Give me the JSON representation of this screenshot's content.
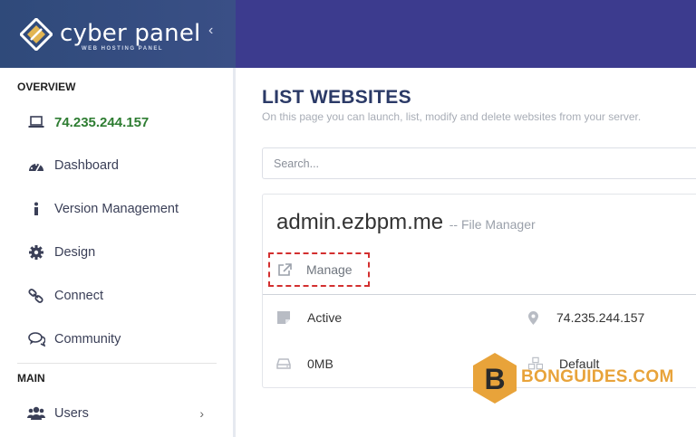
{
  "brand": {
    "name": "cyber panel",
    "tagline": "WEB HOSTING PANEL"
  },
  "sidebar": {
    "overview_title": "OVERVIEW",
    "main_title": "MAIN",
    "items": [
      {
        "label": "74.235.244.157",
        "icon": "laptop-icon"
      },
      {
        "label": "Dashboard",
        "icon": "dashboard-icon"
      },
      {
        "label": "Version Management",
        "icon": "info-icon"
      },
      {
        "label": "Design",
        "icon": "gear-icon"
      },
      {
        "label": "Connect",
        "icon": "link-icon"
      },
      {
        "label": "Community",
        "icon": "comments-icon"
      }
    ],
    "users": {
      "label": "Users",
      "icon": "users-icon"
    }
  },
  "main": {
    "title": "LIST WEBSITES",
    "description": "On this page you can launch, list, modify and delete websites from your server.",
    "search_placeholder": "Search..."
  },
  "website": {
    "domain": "admin.ezbpm.me",
    "file_manager": "-- File Manager",
    "manage_label": "Manage",
    "status": "Active",
    "ip": "74.235.244.157",
    "disk": "0MB",
    "package": "Default"
  },
  "watermark": {
    "text": "BONGUIDES.COM",
    "letter": "B"
  },
  "colors": {
    "topbar": "#3c3b8e",
    "accent_green": "#2e7d32",
    "title": "#2b3a67",
    "highlight_red": "#d32f2f",
    "watermark": "#e8a33a"
  }
}
